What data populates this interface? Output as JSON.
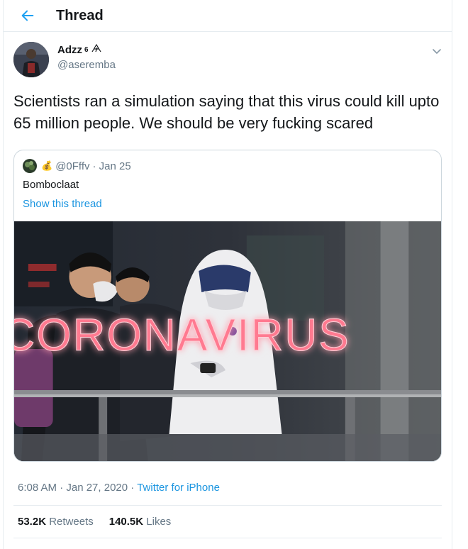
{
  "header": {
    "title": "Thread"
  },
  "author": {
    "display_name": "Adzz",
    "badge": "6",
    "handle": "@aseremba"
  },
  "tweet": {
    "text": "Scientists ran a simulation saying that this virus could kill upto 65 million people. We should be very fucking scared"
  },
  "quote": {
    "emoji": "💰",
    "handle": "@0Fffv",
    "date": "· Jan 25",
    "text": "Bomboclaat",
    "link": "Show this thread",
    "image_text": "CORONAVIRUS"
  },
  "meta": {
    "time": "6:08 AM · Jan 27, 2020 ·",
    "app": "Twitter for iPhone"
  },
  "stats": {
    "retweets_count": "53.2K",
    "retweets_label": "Retweets",
    "likes_count": "140.5K",
    "likes_label": "Likes"
  },
  "colors": {
    "link": "#1b95e0",
    "secondary": "#657786",
    "neon": "#ff5a7a"
  }
}
